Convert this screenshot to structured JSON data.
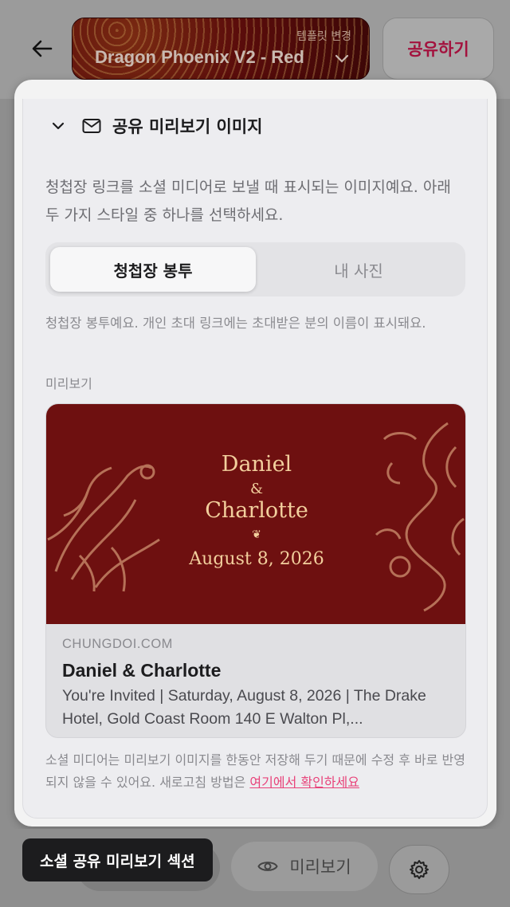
{
  "header": {
    "template_sub_label": "템플릿 변경",
    "template_name": "Dragon Phoenix V2 - Red",
    "share_label": "공유하기"
  },
  "section": {
    "title": "공유 미리보기 이미지",
    "description": "청첩장 링크를 소셜 미디어로 보낼 때 표시되는 이미지예요. 아래 두 가지 스타일 중 하나를 선택하세요.",
    "segment": {
      "options": [
        "청첩장 봉투",
        "내 사진"
      ],
      "selected": "청첩장 봉투"
    },
    "hint": "청첩장 봉투예요. 개인 초대 링크에는 초대받은 분의 이름이 표시돼요.",
    "preview_label": "미리보기",
    "preview": {
      "name1": "Daniel",
      "ampersand": "&",
      "name2": "Charlotte",
      "ornament": "❦",
      "date": "August 8, 2026",
      "domain": "CHUNGDOI.COM",
      "title": "Daniel & Charlotte",
      "description": "You're Invited | Saturday, August 8, 2026 | The Drake Hotel, Gold Coast Room 140 E Walton Pl,..."
    },
    "note_text": "소셜 미디어는 미리보기 이미지를 한동안 저장해 두기 때문에 수정 후 바로 반영되지 않을 수 있어요. 새로고침 방법은 ",
    "note_link": "여기에서 확인하세요"
  },
  "bottom_bar": {
    "preview_label": "미리보기"
  },
  "tooltip": "소셜 공유 미리보기 섹션",
  "colors": {
    "accent": "#e8437a",
    "share_text": "#a3123e",
    "hero_bg": "#6e1010",
    "hero_text": "#f2cf9d"
  }
}
